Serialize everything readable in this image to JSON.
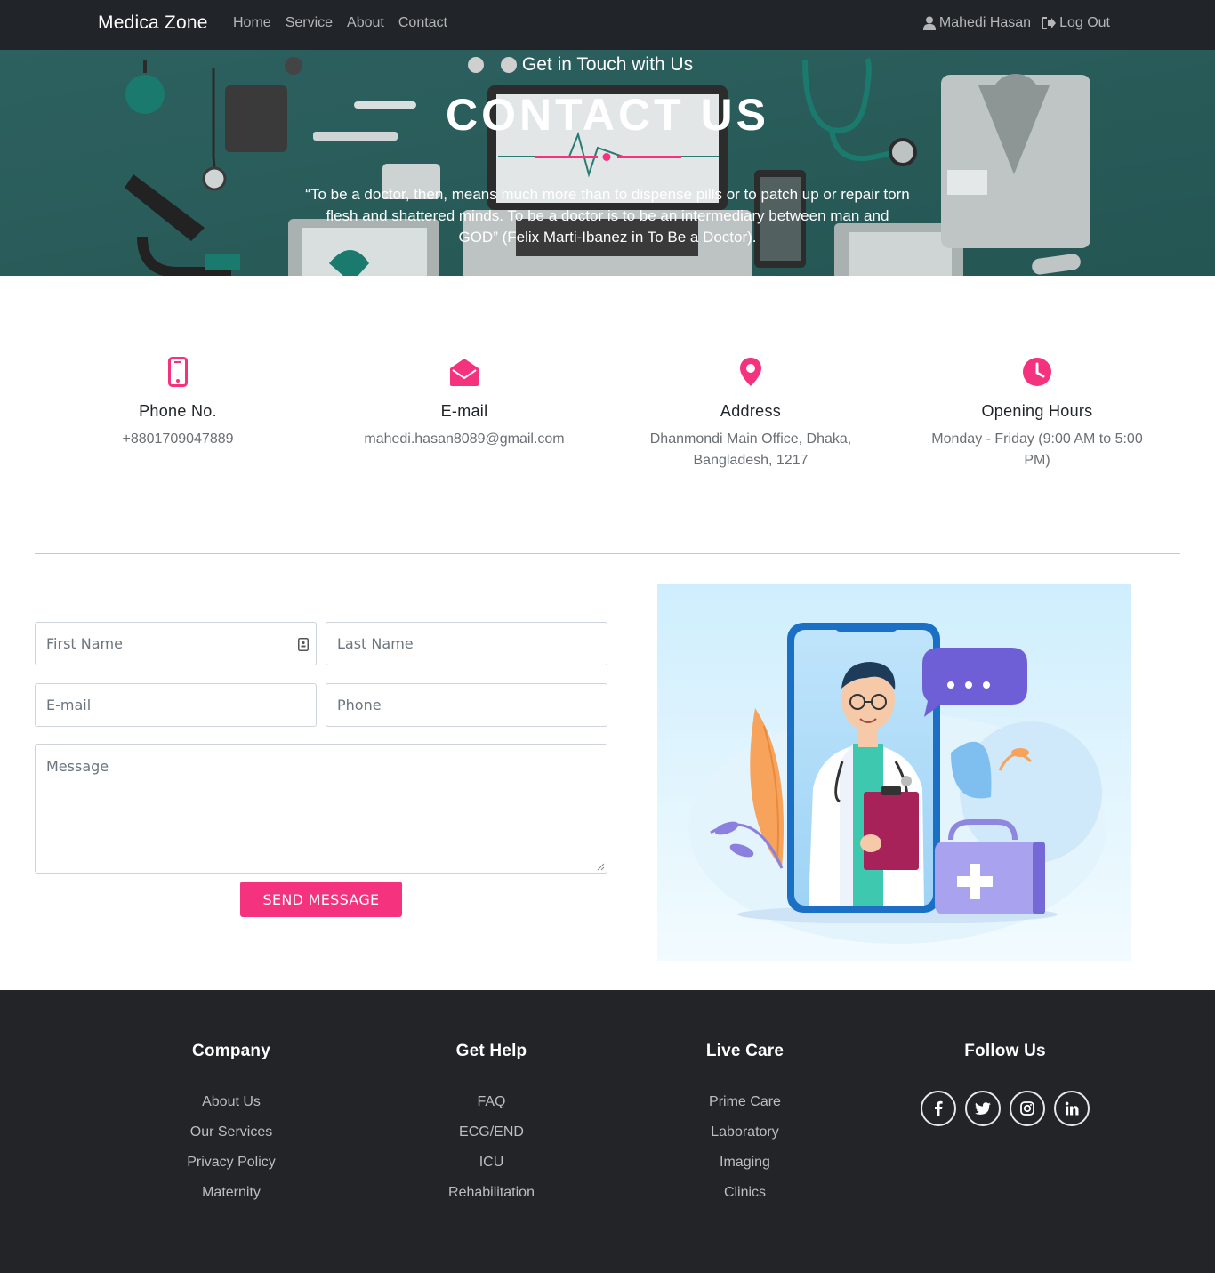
{
  "nav": {
    "brand": "Medica Zone",
    "links": [
      "Home",
      "Service",
      "About",
      "Contact"
    ],
    "user": "Mahedi Hasan",
    "logout": "Log Out"
  },
  "hero": {
    "subtitle": "Get in Touch with Us",
    "title": "CONTACT US",
    "quote": "“To be a doctor, then, means much more than to dispense pills or to patch up or repair torn flesh and shattered minds. To be a doctor is to be an intermediary between man and GOD” (Felix Marti-Ibanez in To Be a Doctor)."
  },
  "info": [
    {
      "icon": "mobile-phone-icon",
      "title": "Phone No.",
      "value": "+8801709047889"
    },
    {
      "icon": "envelope-open-icon",
      "title": "E-mail",
      "value": "mahedi.hasan8089@gmail.com"
    },
    {
      "icon": "map-marker-icon",
      "title": "Address",
      "value": "Dhanmondi Main Office, Dhaka, Bangladesh, 1217"
    },
    {
      "icon": "clock-icon",
      "title": "Opening Hours",
      "value": "Monday - Friday (9:00 AM to 5:00 PM)"
    }
  ],
  "form": {
    "first_name": "First Name",
    "last_name": "Last Name",
    "email": "E-mail",
    "phone": "Phone",
    "message": "Message",
    "submit": "SEND MESSAGE"
  },
  "footer": {
    "columns": [
      {
        "title": "Company",
        "items": [
          "About Us",
          "Our Services",
          "Privacy Policy",
          "Maternity"
        ]
      },
      {
        "title": "Get Help",
        "items": [
          "FAQ",
          "ECG/END",
          "ICU",
          "Rehabilitation"
        ]
      },
      {
        "title": "Live Care",
        "items": [
          "Prime Care",
          "Laboratory",
          "Imaging",
          "Clinics"
        ]
      }
    ],
    "follow_title": "Follow Us",
    "social": [
      "facebook-icon",
      "twitter-icon",
      "instagram-icon",
      "linkedin-icon"
    ]
  },
  "colors": {
    "accent": "#f5327e",
    "dark": "#212529",
    "hero_teal": "#2f6e6c"
  }
}
